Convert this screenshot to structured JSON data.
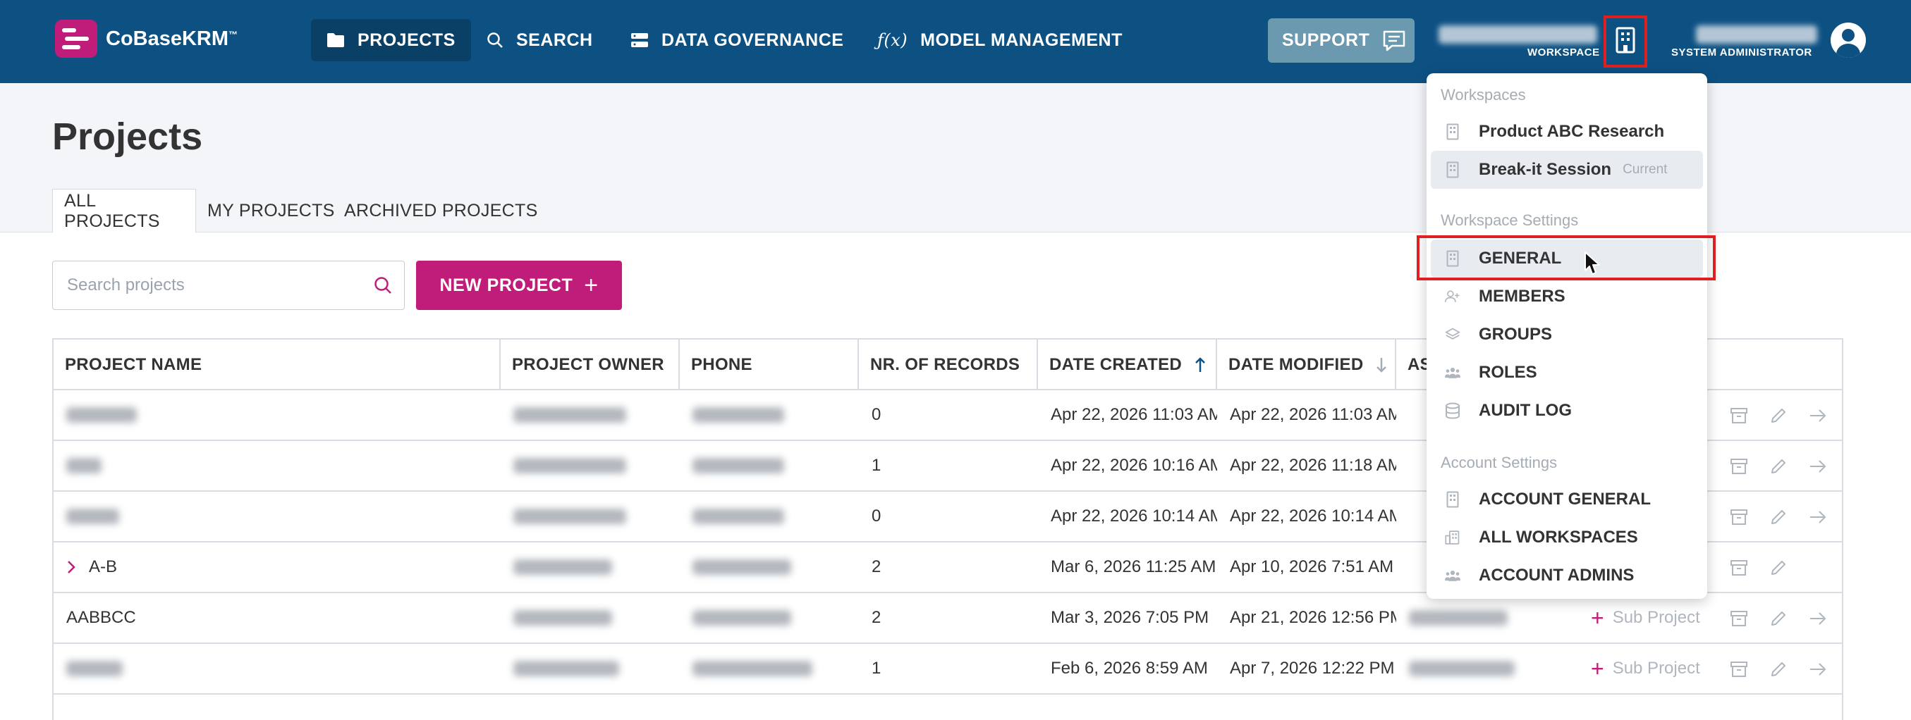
{
  "app": {
    "name": "CoBaseKRM",
    "trademark": "™"
  },
  "nav": {
    "projects": "PROJECTS",
    "search": "SEARCH",
    "data_governance": "DATA GOVERNANCE",
    "model_management": "MODEL MANAGEMENT",
    "support": "SUPPORT",
    "workspace_label": "WORKSPACE",
    "role_label": "SYSTEM ADMINISTRATOR"
  },
  "page": {
    "title": "Projects",
    "tabs": [
      {
        "label": "ALL PROJECTS",
        "active": true
      },
      {
        "label": "MY PROJECTS",
        "active": false
      },
      {
        "label": "ARCHIVED PROJECTS",
        "active": false
      }
    ],
    "search_placeholder": "Search projects",
    "new_project_label": "NEW PROJECT"
  },
  "table": {
    "columns": [
      "PROJECT NAME",
      "PROJECT OWNER",
      "PHONE",
      "NR. OF RECORDS",
      "DATE CREATED",
      "DATE MODIFIED",
      "AS"
    ],
    "rows": [
      {
        "name": "",
        "records": "0",
        "created": "Apr 22, 2026 11:03 AM",
        "modified": "Apr 22, 2026 11:03 AM",
        "expandable": false
      },
      {
        "name": "",
        "records": "1",
        "created": "Apr 22, 2026 10:16 AM",
        "modified": "Apr 22, 2026 11:18 AM",
        "expandable": false
      },
      {
        "name": "",
        "records": "0",
        "created": "Apr 22, 2026 10:14 AM",
        "modified": "Apr 22, 2026 10:14 AM",
        "expandable": false
      },
      {
        "name": "A-B",
        "records": "2",
        "created": "Mar 6, 2026 11:25 AM",
        "modified": "Apr 10, 2026 7:51 AM",
        "expandable": true
      },
      {
        "name": "AABBCC",
        "records": "2",
        "created": "Mar 3, 2026 7:05 PM",
        "modified": "Apr 21, 2026 12:56 PM",
        "expandable": false,
        "sub_project": "Sub Project"
      },
      {
        "name": "",
        "records": "1",
        "created": "Feb 6, 2026 8:59 AM",
        "modified": "Apr 7, 2026 12:22 PM",
        "expandable": false,
        "sub_project": "Sub Project"
      }
    ]
  },
  "dropdown": {
    "workspaces_header": "Workspaces",
    "workspaces": [
      {
        "label": "Product ABC Research",
        "current": false
      },
      {
        "label": "Break-it Session",
        "current": true
      }
    ],
    "current_label": "Current",
    "workspace_settings_header": "Workspace Settings",
    "workspace_settings": [
      {
        "label": "GENERAL",
        "icon": "building-icon"
      },
      {
        "label": "MEMBERS",
        "icon": "add-user-icon"
      },
      {
        "label": "GROUPS",
        "icon": "layers-icon"
      },
      {
        "label": "ROLES",
        "icon": "people-icon"
      },
      {
        "label": "AUDIT LOG",
        "icon": "database-icon"
      }
    ],
    "account_settings_header": "Account Settings",
    "account_settings": [
      {
        "label": "ACCOUNT GENERAL",
        "icon": "building-icon"
      },
      {
        "label": "ALL WORKSPACES",
        "icon": "buildings-icon"
      },
      {
        "label": "ACCOUNT ADMINS",
        "icon": "people-icon"
      }
    ]
  },
  "colors": {
    "header": "#0d5183",
    "accent": "#c01d7a",
    "highlight": "#e02020"
  }
}
